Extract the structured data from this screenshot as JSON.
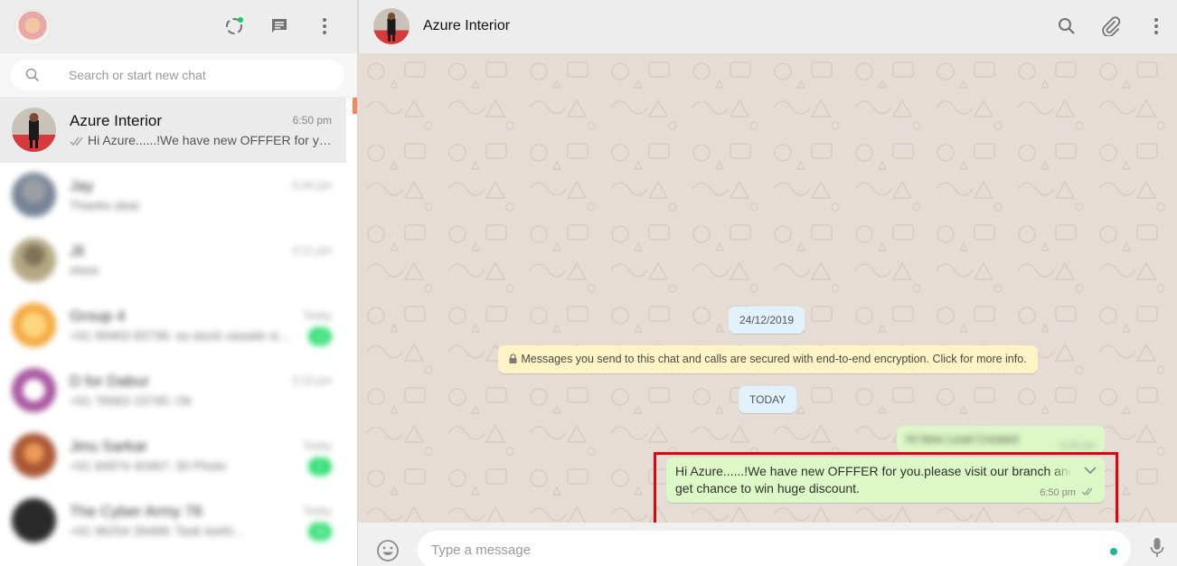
{
  "colors": {
    "header_bg": "#ededed",
    "chat_bg": "#e5ddd5",
    "outgoing_bubble": "#dcf8c6",
    "date_pill": "#e1f2fb",
    "encryption_note": "#fdf4c5",
    "unread_badge": "#06d755",
    "highlight_border": "#e8000b",
    "status_dot": "#1fb694"
  },
  "left_header": {
    "icons": [
      "status-icon",
      "new-chat-icon",
      "menu-icon"
    ]
  },
  "search": {
    "placeholder": "Search or start new chat",
    "icon": "search-icon"
  },
  "chats": [
    {
      "name": "Azure Interior",
      "time": "6:50 pm",
      "preview": "Hi Azure......!We have new OFFFER for you.please visit our branch and get chance to win huge discount.",
      "ticks": "double-check",
      "active": true
    },
    {
      "name": "Jay",
      "time": "6:44 pm",
      "preview": "Thanks dear",
      "blurred": true
    },
    {
      "name": "Jil",
      "time": "6:11 pm",
      "preview": "Ahmi",
      "blurred": true
    },
    {
      "name": "Group 4",
      "time": "Today",
      "preview": "+91 99463 65736: sa stock vasaite sibu...",
      "unread": "12",
      "blurred": true
    },
    {
      "name": "D for Dabur",
      "time": "5:10 pm",
      "preview": "+91 76563 15745: Ok",
      "blurred": true
    },
    {
      "name": "Jinu Sarkar",
      "time": "Today",
      "preview": "+91 84974 40467: 30 Photo",
      "unread": "5",
      "blurred": true
    },
    {
      "name": "The Cyber Army 78",
      "time": "Today",
      "preview": "+91 96254 39468: Task teeth...",
      "unread": "26",
      "blurred": true
    }
  ],
  "conversation": {
    "title": "Azure Interior",
    "header_icons": [
      "search-icon",
      "attach-icon",
      "menu-icon"
    ],
    "date_label": "24/12/2019",
    "encryption_notice": "Messages you send to this chat and calls are secured with end-to-end encryption. Click for more info.",
    "today_label": "TODAY",
    "messages": [
      {
        "text": "Hi New Lead Created",
        "time": "4:29 pm",
        "blurred": true
      },
      {
        "text": "Hi Azure......!We have new OFFFER for you.please visit our branch and get chance to win huge discount.",
        "time": "6:50 pm"
      }
    ]
  },
  "composer": {
    "placeholder": "Type a message"
  }
}
